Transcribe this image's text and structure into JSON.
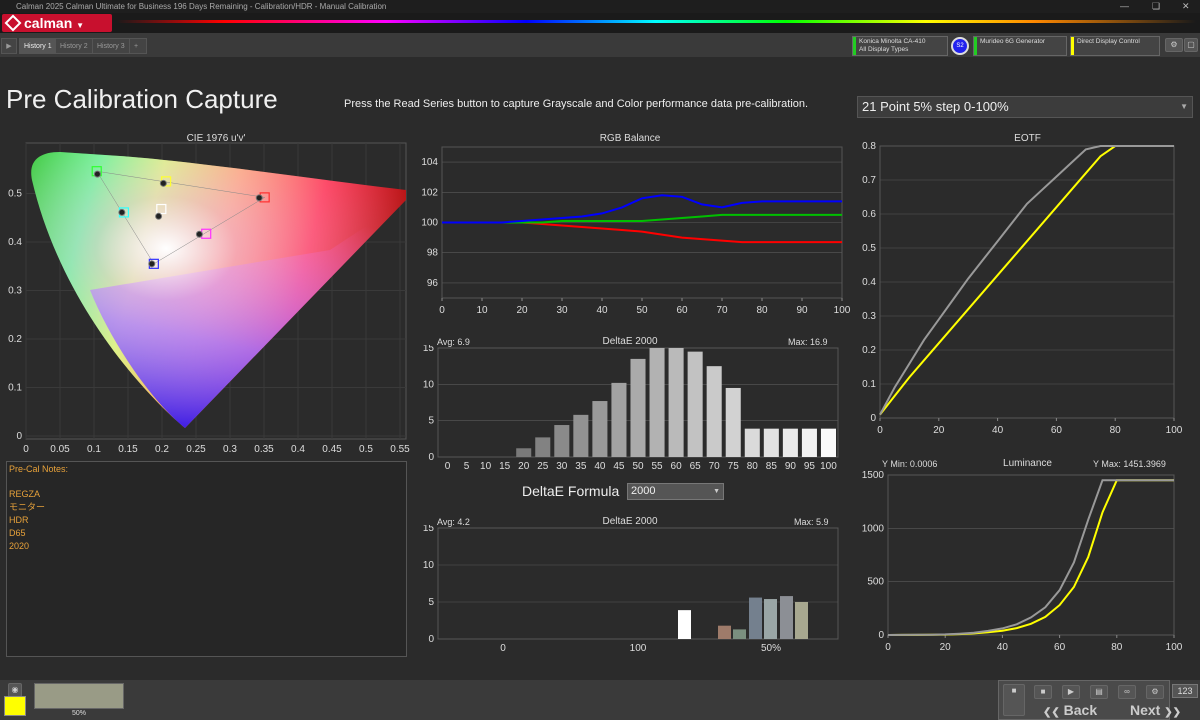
{
  "window": {
    "title": "Calman 2025 Calman Ultimate for Business 196 Days Remaining  - Calibration/HDR - Manual Calibration"
  },
  "tabs": [
    "History 1",
    "History 2",
    "History 3"
  ],
  "devices": {
    "meter": {
      "name": "Konica Minolta CA-410",
      "sub": "All Display Types",
      "badge": "S2",
      "color": "#22cc22"
    },
    "generator": {
      "name": "Murideo 6G Generator",
      "color": "#22cc22"
    },
    "display": {
      "name": "Direct Display Control",
      "color": "#ffff00"
    }
  },
  "page": {
    "title": "Pre Calibration Capture",
    "instruction": "Press the Read Series button to capture Grayscale and Color performance data pre-calibration.",
    "series_select": "21 Point 5% step 0-100%"
  },
  "cie": {
    "title": "CIE 1976 u'v'",
    "x_ticks": [
      "0",
      "0.05",
      "0.1",
      "0.15",
      "0.2",
      "0.25",
      "0.3",
      "0.35",
      "0.4",
      "0.45",
      "0.5",
      "0.55"
    ],
    "y_ticks": [
      "0",
      "0.1",
      "0.2",
      "0.3",
      "0.4",
      "0.5"
    ],
    "targets": [
      {
        "u": 0.351,
        "v": 0.492,
        "color": "#ff3030"
      },
      {
        "u": 0.104,
        "v": 0.546,
        "color": "#30ff30"
      },
      {
        "u": 0.188,
        "v": 0.355,
        "color": "#3030ff"
      },
      {
        "u": 0.144,
        "v": 0.461,
        "color": "#30ffff"
      },
      {
        "u": 0.265,
        "v": 0.417,
        "color": "#ff30ff"
      },
      {
        "u": 0.206,
        "v": 0.525,
        "color": "#ffff30"
      },
      {
        "u": 0.199,
        "v": 0.468,
        "color": "#ffffff"
      }
    ],
    "measured": [
      {
        "u": 0.343,
        "v": 0.491
      },
      {
        "u": 0.105,
        "v": 0.54
      },
      {
        "u": 0.185,
        "v": 0.355
      },
      {
        "u": 0.141,
        "v": 0.461
      },
      {
        "u": 0.255,
        "v": 0.416
      },
      {
        "u": 0.202,
        "v": 0.521
      },
      {
        "u": 0.195,
        "v": 0.453
      }
    ]
  },
  "notes": {
    "header": "Pre-Cal Notes:",
    "lines": [
      "REGZA",
      "モニター",
      "HDR",
      "D65",
      "2020"
    ]
  },
  "rgb_balance": {
    "title": "RGB Balance",
    "chart_data": {
      "type": "line",
      "x": [
        0,
        5,
        10,
        15,
        20,
        25,
        30,
        35,
        40,
        45,
        50,
        55,
        60,
        65,
        70,
        75,
        80,
        85,
        90,
        95,
        100
      ],
      "series": [
        {
          "color": "#ff0000",
          "values": [
            100,
            100,
            100,
            100,
            100,
            99.9,
            99.8,
            99.7,
            99.6,
            99.5,
            99.4,
            99.2,
            99.0,
            98.9,
            98.8,
            98.7,
            98.7,
            98.7,
            98.7,
            98.7,
            98.7
          ]
        },
        {
          "color": "#00c000",
          "values": [
            100,
            100,
            100,
            100,
            100,
            100,
            100.1,
            100.1,
            100.1,
            100.1,
            100.1,
            100.2,
            100.3,
            100.4,
            100.5,
            100.5,
            100.5,
            100.5,
            100.5,
            100.5,
            100.5
          ]
        },
        {
          "color": "#0000ff",
          "values": [
            100,
            100,
            100,
            100,
            100.1,
            100.2,
            100.3,
            100.4,
            100.6,
            101.0,
            101.6,
            101.8,
            101.7,
            101.2,
            101.0,
            101.3,
            101.4,
            101.4,
            101.4,
            101.4,
            101.4
          ]
        }
      ],
      "ylim": [
        95,
        105
      ],
      "y_ticks": [
        "96",
        "98",
        "100",
        "102",
        "104"
      ],
      "x_ticks": [
        "0",
        "10",
        "20",
        "30",
        "40",
        "50",
        "60",
        "70",
        "80",
        "90",
        "100"
      ]
    }
  },
  "deltae_gray": {
    "title": "DeltaE 2000",
    "avg": "Avg: 6.9",
    "max": "Max: 16.9",
    "chart_data": {
      "type": "bar",
      "categories": [
        "0",
        "5",
        "10",
        "15",
        "20",
        "25",
        "30",
        "35",
        "40",
        "45",
        "50",
        "55",
        "60",
        "65",
        "70",
        "75",
        "80",
        "85",
        "90",
        "95",
        "100"
      ],
      "values": [
        0,
        0,
        0,
        0,
        1.2,
        2.7,
        4.4,
        5.8,
        7.7,
        10.2,
        13.5,
        16.9,
        15.2,
        14.5,
        12.5,
        9.5,
        3.9,
        3.9,
        3.9,
        3.9,
        3.9
      ],
      "ylim": [
        0,
        15
      ],
      "y_ticks": [
        "0",
        "5",
        "10",
        "15"
      ]
    }
  },
  "formula": {
    "label": "DeltaE Formula",
    "value": "2000"
  },
  "deltae_color": {
    "title": "DeltaE 2000",
    "avg": "Avg: 4.2",
    "max": "Max: 5.9",
    "chart_data": {
      "type": "bar",
      "x_ticks": [
        "0",
        "100",
        "50%"
      ],
      "bars": [
        {
          "value": 3.9,
          "color": "#ffffff"
        },
        {
          "value": 1.8,
          "color": "#9e7b6a"
        },
        {
          "value": 1.3,
          "color": "#7a8f7f"
        },
        {
          "value": 5.6,
          "color": "#74808e"
        },
        {
          "value": 5.4,
          "color": "#9aa6a6"
        },
        {
          "value": 5.8,
          "color": "#8c8f95"
        },
        {
          "value": 5.0,
          "color": "#a8a890"
        }
      ],
      "ylim": [
        0,
        15
      ],
      "y_ticks": [
        "0",
        "5",
        "10",
        "15"
      ]
    }
  },
  "eotf": {
    "title": "EOTF",
    "chart_data": {
      "type": "line",
      "x": [
        0,
        5,
        10,
        15,
        20,
        25,
        30,
        35,
        40,
        45,
        50,
        55,
        60,
        65,
        70,
        75,
        80,
        85,
        90,
        95,
        100
      ],
      "series": [
        {
          "color": "#ffff00",
          "values": [
            0.01,
            0.065,
            0.12,
            0.17,
            0.22,
            0.27,
            0.32,
            0.37,
            0.42,
            0.47,
            0.52,
            0.57,
            0.62,
            0.67,
            0.72,
            0.77,
            0.8,
            0.8,
            0.8,
            0.8,
            0.8
          ]
        },
        {
          "color": "#999999",
          "values": [
            0.01,
            0.09,
            0.16,
            0.23,
            0.29,
            0.35,
            0.41,
            0.465,
            0.52,
            0.575,
            0.63,
            0.67,
            0.71,
            0.75,
            0.79,
            0.8,
            0.8,
            0.8,
            0.8,
            0.8,
            0.8
          ]
        }
      ],
      "ylim": [
        0,
        0.8
      ],
      "y_ticks": [
        "0",
        "0.1",
        "0.2",
        "0.3",
        "0.4",
        "0.5",
        "0.6",
        "0.7",
        "0.8"
      ],
      "x_ticks": [
        "0",
        "20",
        "40",
        "60",
        "80",
        "100"
      ]
    }
  },
  "luminance": {
    "title": "Luminance",
    "ymin": "Y Min: 0.0006",
    "ymax": "Y Max: 1451.3969",
    "chart_data": {
      "type": "line",
      "x": [
        0,
        5,
        10,
        15,
        20,
        25,
        30,
        35,
        40,
        45,
        50,
        55,
        60,
        65,
        70,
        75,
        80,
        85,
        90,
        95,
        100
      ],
      "series": [
        {
          "color": "#ffff00",
          "values": [
            0,
            0.5,
            1,
            2,
            4,
            8,
            15,
            25,
            40,
            65,
            105,
            170,
            280,
            450,
            730,
            1150,
            1451,
            1451,
            1451,
            1451,
            1451
          ]
        },
        {
          "color": "#999999",
          "values": [
            0,
            0.6,
            1.5,
            3,
            6,
            12,
            22,
            38,
            62,
            100,
            165,
            260,
            420,
            680,
            1080,
            1451,
            1451,
            1451,
            1451,
            1451,
            1451
          ]
        }
      ],
      "ylim": [
        0,
        1500
      ],
      "y_ticks": [
        "0",
        "500",
        "1000",
        "1500"
      ],
      "x_ticks": [
        "0",
        "20",
        "40",
        "60",
        "80",
        "100"
      ]
    }
  },
  "bottom": {
    "swatch_label": "50%",
    "back": "Back",
    "next": "Next",
    "counter": "123"
  }
}
